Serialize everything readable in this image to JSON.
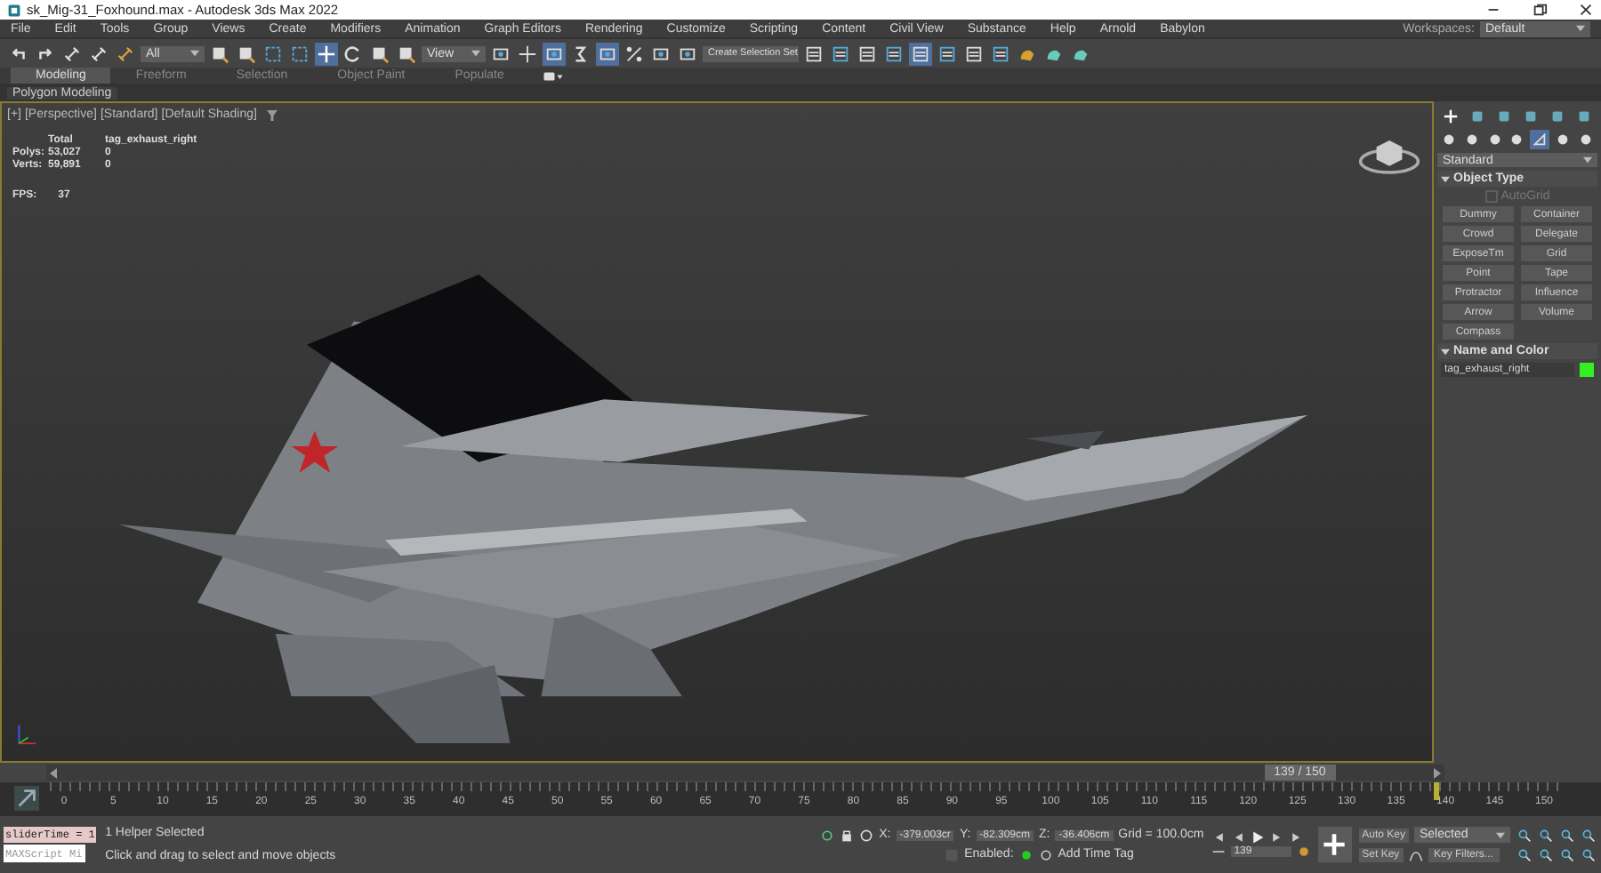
{
  "window": {
    "title": "sk_Mig-31_Foxhound.max - Autodesk 3ds Max 2022"
  },
  "menu": {
    "items": [
      "File",
      "Edit",
      "Tools",
      "Group",
      "Views",
      "Create",
      "Modifiers",
      "Animation",
      "Graph Editors",
      "Rendering",
      "Customize",
      "Scripting",
      "Content",
      "Civil View",
      "Substance",
      "Help",
      "Arnold",
      "Babylon"
    ],
    "workspaces_label": "Workspaces:",
    "workspaces_value": "Default"
  },
  "toolbar": {
    "selection_filter": "All",
    "reference_coord": "View",
    "named_selection": "Create Selection Set"
  },
  "ribbon": {
    "tabs": [
      {
        "label": "Modeling",
        "selected": true
      },
      {
        "label": "Freeform",
        "selected": false
      },
      {
        "label": "Selection",
        "selected": false
      },
      {
        "label": "Object Paint",
        "selected": false
      },
      {
        "label": "Populate",
        "selected": false
      }
    ],
    "panel": "Polygon Modeling"
  },
  "viewport": {
    "labels": [
      "[+]",
      "[Perspective]",
      "[Standard]",
      "[Default Shading]"
    ],
    "stats": {
      "columns": [
        "Total",
        "tag_exhaust_right"
      ],
      "rows": [
        {
          "label": "Polys:",
          "total": "53,027",
          "selected": "0"
        },
        {
          "label": "Verts:",
          "total": "59,891",
          "selected": "0"
        }
      ],
      "fps_label": "FPS:",
      "fps": "37"
    }
  },
  "command_panel": {
    "category": "Standard",
    "object_type_title": "Object Type",
    "autogrid": {
      "label": "AutoGrid",
      "checked": false,
      "disabled": true
    },
    "buttons": [
      "Dummy",
      "Container",
      "Crowd",
      "Delegate",
      "ExposeTm",
      "Grid",
      "Point",
      "Tape",
      "Protractor",
      "Influence",
      "Arrow",
      "Volume",
      "Compass"
    ],
    "name_color_title": "Name and Color",
    "object_name": "tag_exhaust_right",
    "color": "#33ee22"
  },
  "time_slider": {
    "label": "139 / 150",
    "level": 0.927
  },
  "track_bar": {
    "ticks": [
      "0",
      "5",
      "10",
      "15",
      "20",
      "25",
      "30",
      "35",
      "40",
      "45",
      "50",
      "55",
      "60",
      "65",
      "70",
      "75",
      "80",
      "85",
      "90",
      "95",
      "100",
      "105",
      "110",
      "115",
      "120",
      "125",
      "130",
      "135",
      "140",
      "145",
      "150"
    ],
    "level": 0.927
  },
  "status_bar": {
    "maxscript_value": "sliderTime = 1",
    "maxscript_placeholder": "MAXScript Mi",
    "selection_info": "1 Helper Selected",
    "prompt": "Click and drag to select and move objects",
    "x_label": "X:",
    "x": "-379.003cr",
    "y_label": "Y:",
    "y": "-82.309cm",
    "z_label": "Z:",
    "z": "-36.406cm",
    "grid": "Grid = 100.0cm",
    "enabled_label": "Enabled:",
    "add_time_tag": "Add Time Tag",
    "frame": "139",
    "auto_key": "Auto Key",
    "key_mode": "Selected",
    "set_key": "Set Key",
    "key_filters": "Key Filters..."
  }
}
